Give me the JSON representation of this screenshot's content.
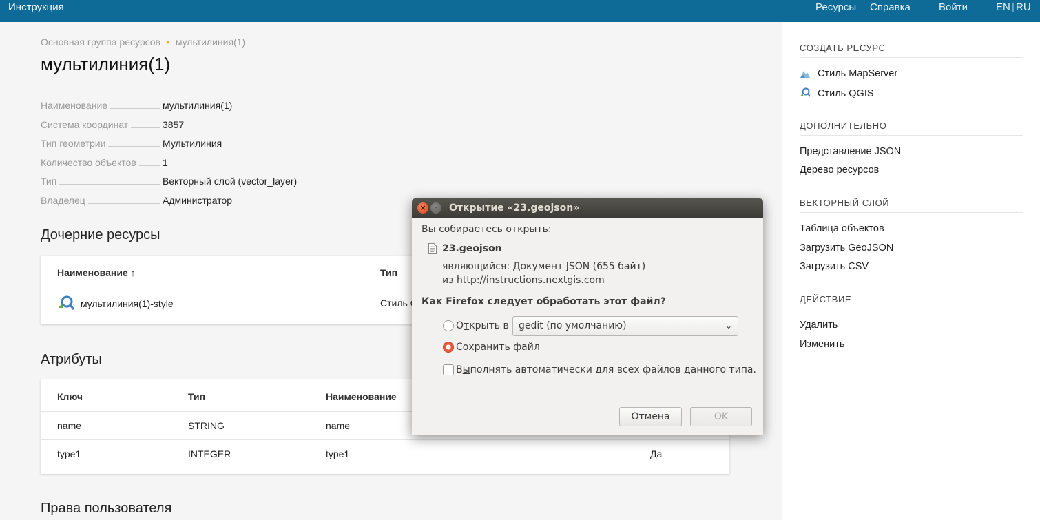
{
  "topbar": {
    "brand": "Инструкция",
    "nav": [
      "Ресурсы",
      "Справка",
      "Войти"
    ],
    "lang_en": "EN",
    "lang_sep": "|",
    "lang_ru": "RU"
  },
  "breadcrumb": {
    "parent": "Основная группа ресурсов",
    "current": "мультилиния(1)"
  },
  "page_title": "мультилиния(1)",
  "properties": [
    {
      "key": "Наименование",
      "value": "мультилиния(1)"
    },
    {
      "key": "Система координат",
      "value": "3857"
    },
    {
      "key": "Тип геометрии",
      "value": "Мультилиния"
    },
    {
      "key": "Количество объектов",
      "value": "1"
    },
    {
      "key": "Тип",
      "value": "Векторный слой (vector_layer)"
    },
    {
      "key": "Владелец",
      "value": "Администратор"
    }
  ],
  "children": {
    "heading": "Дочерние ресурсы",
    "col_name": "Наименование",
    "col_type": "Тип",
    "rows": [
      {
        "name": "мультилиния(1)-style",
        "type": "Стиль QGIS"
      }
    ]
  },
  "attributes": {
    "heading": "Атрибуты",
    "col_key": "Ключ",
    "col_type": "Тип",
    "col_name": "Наименование",
    "rows": [
      {
        "key": "name",
        "type": "STRING",
        "name": "name",
        "flag": ""
      },
      {
        "key": "type1",
        "type": "INTEGER",
        "name": "type1",
        "flag": "Да"
      }
    ]
  },
  "permissions_heading": "Права пользователя",
  "sidebar": {
    "create_heading": "СОЗДАТЬ РЕСУРС",
    "create_items": [
      "Стиль MapServer",
      "Стиль QGIS"
    ],
    "extra_heading": "ДОПОЛНИТЕЛЬНО",
    "extra_items": [
      "Представление JSON",
      "Дерево ресурсов"
    ],
    "vector_heading": "ВЕКТОРНЫЙ СЛОЙ",
    "vector_items": [
      "Таблица объектов",
      "Загрузить GeoJSON",
      "Загрузить CSV"
    ],
    "action_heading": "ДЕЙСТВИЕ",
    "action_items": [
      "Удалить",
      "Изменить"
    ]
  },
  "dialog": {
    "title": "Открытие «23.geojson»",
    "intro": "Вы собираетесь открыть:",
    "filename": "23.geojson",
    "type_label": "являющийся:",
    "type_value": "Документ JSON (655 байт)",
    "from_label": "из",
    "from_value": "http://instructions.nextgis.com",
    "question": "Как Firefox следует обработать этот файл?",
    "open_with_pre": "О",
    "open_with_u": "т",
    "open_with_post": "крыть в",
    "app_selected": "gedit (по умолчанию)",
    "save_pre": "Со",
    "save_u": "х",
    "save_post": "ранить файл",
    "auto_pre": "В",
    "auto_u": "ы",
    "auto_post": "полнять автоматически для всех файлов данного типа.",
    "cancel": "Отмена",
    "ok": "OK",
    "selected_option": "save"
  },
  "colors": {
    "topbar": "#0e6b97",
    "accent_dot": "#f0a830",
    "radio_on": "#e8593a"
  }
}
